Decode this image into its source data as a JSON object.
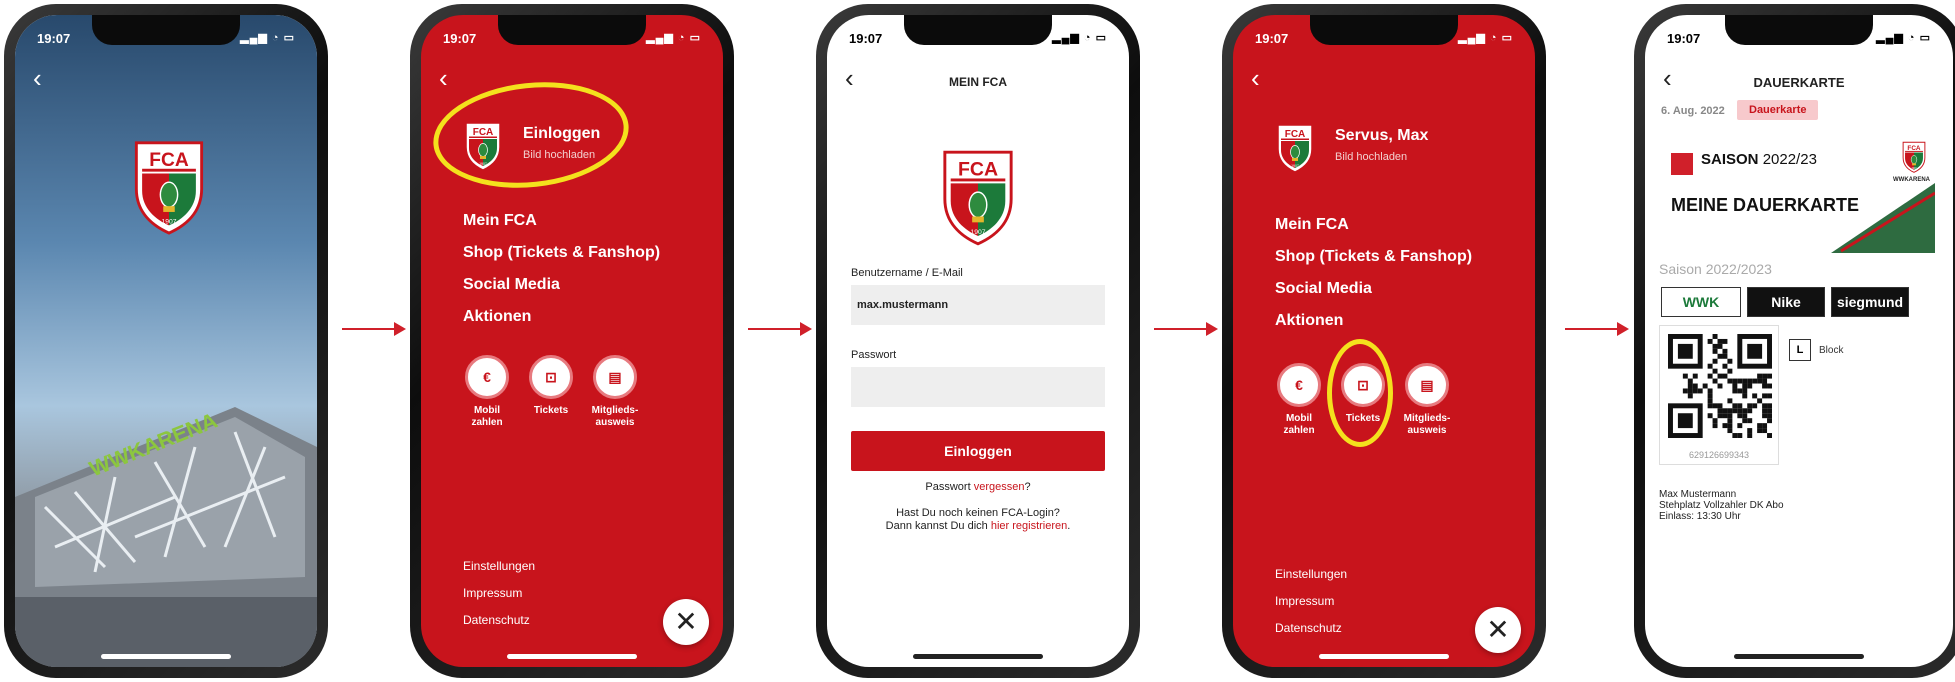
{
  "status": {
    "time": "19:07"
  },
  "crest": {
    "letters": "FCA",
    "year": "1907"
  },
  "phone1": {
    "arena_text": "WWKARENA"
  },
  "menu": {
    "login_title": "Einloggen",
    "login_sub": "Bild hochladen",
    "greeting": "Servus, Max",
    "greeting_sub": "Bild hochladen",
    "items": [
      "Mein FCA",
      "Shop (Tickets & Fanshop)",
      "Social Media",
      "Aktionen"
    ],
    "quick": [
      {
        "icon": "€",
        "label_1": "Mobil",
        "label_2": "zahlen"
      },
      {
        "icon": "⊡",
        "label_1": "Tickets",
        "label_2": ""
      },
      {
        "icon": "▤",
        "label_1": "Mitglieds-",
        "label_2": "ausweis"
      }
    ],
    "footer": [
      "Einstellungen",
      "Impressum",
      "Datenschutz"
    ],
    "close": "✕"
  },
  "login": {
    "title": "MEIN FCA",
    "user_label": "Benutzername / E-Mail",
    "user_value": "max.mustermann",
    "pass_label": "Passwort",
    "button": "Einloggen",
    "forgot_prefix": "Passwort ",
    "forgot_link": "vergessen",
    "forgot_suffix": "?",
    "reg_line1": "Hast Du noch keinen FCA-Login?",
    "reg_prefix": "Dann kannst Du dich ",
    "reg_link": "hier registrieren",
    "reg_suffix": "."
  },
  "ticket": {
    "title": "DAUERKARTE",
    "date": "6. Aug. 2022",
    "badge": "Dauerkarte",
    "saison_bold": "SAISON",
    "saison_year": "2022/23",
    "meine": "MEINE DAUERKARTE",
    "arena_small": "WWKARENA",
    "saison_full": "Saison 2022/2023",
    "sponsors": [
      "WWK",
      "Nike",
      "siegmund"
    ],
    "qr_number": "629126699343",
    "block_letter": "L",
    "block_label": "Block",
    "holder": "Max Mustermann",
    "seat": "Stehplatz Vollzahler DK Abo",
    "entry": "Einlass: 13:30 Uhr"
  },
  "colors": {
    "fca_red": "#c8141c",
    "highlight": "#f4e11d",
    "arrow": "#d0202a"
  }
}
